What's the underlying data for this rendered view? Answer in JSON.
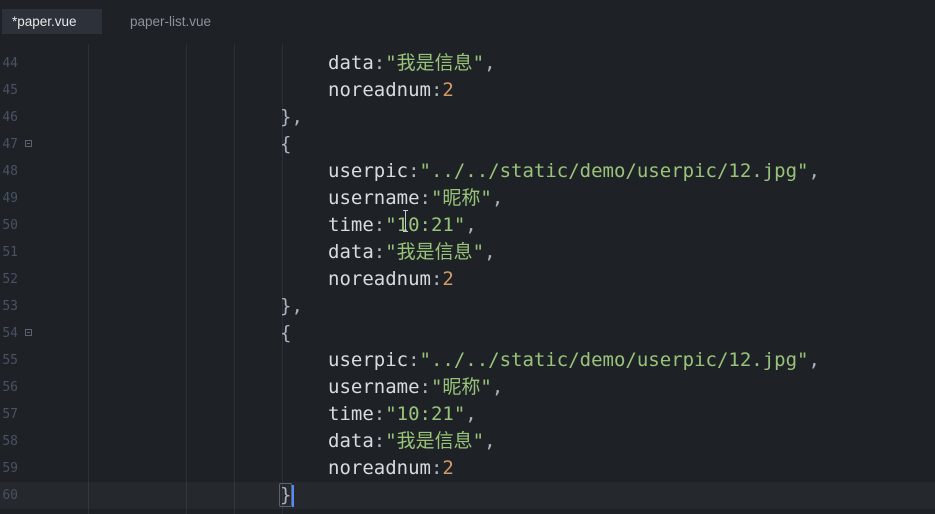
{
  "tabs": [
    {
      "label": "*paper.vue",
      "active": true
    },
    {
      "label": "paper-list.vue",
      "active": false
    }
  ],
  "colors": {
    "background": "#1e2227",
    "line_number": "#495162",
    "key": "#d7dae0",
    "string": "#98c379",
    "number": "#d19a66",
    "punctuation": "#abb2bf",
    "cursor": "#528bff"
  },
  "lines": [
    {
      "n": "44",
      "fold": false,
      "tokens": [
        [
          "key",
          "data"
        ],
        [
          "punc",
          ":"
        ],
        [
          "str",
          "\"我是信息\""
        ],
        [
          "punc",
          ","
        ]
      ],
      "indent": 2
    },
    {
      "n": "45",
      "fold": false,
      "tokens": [
        [
          "key",
          "noreadnum"
        ],
        [
          "punc",
          ":"
        ],
        [
          "num",
          "2"
        ]
      ],
      "indent": 2
    },
    {
      "n": "46",
      "fold": false,
      "tokens": [
        [
          "brace",
          "}"
        ],
        [
          "punc",
          ","
        ]
      ],
      "indent": 1
    },
    {
      "n": "47",
      "fold": true,
      "tokens": [
        [
          "brace",
          "{"
        ]
      ],
      "indent": 1
    },
    {
      "n": "48",
      "fold": false,
      "tokens": [
        [
          "key",
          "userpic"
        ],
        [
          "punc",
          ":"
        ],
        [
          "str",
          "\"../../static/demo/userpic/12.jpg\""
        ],
        [
          "punc",
          ","
        ]
      ],
      "indent": 2
    },
    {
      "n": "49",
      "fold": false,
      "tokens": [
        [
          "key",
          "username"
        ],
        [
          "punc",
          ":"
        ],
        [
          "str",
          "\"昵称\""
        ],
        [
          "punc",
          ","
        ]
      ],
      "indent": 2
    },
    {
      "n": "50",
      "fold": false,
      "tokens": [
        [
          "key",
          "time"
        ],
        [
          "punc",
          ":"
        ],
        [
          "str",
          "\"10:21\""
        ],
        [
          "punc",
          ","
        ]
      ],
      "indent": 2
    },
    {
      "n": "51",
      "fold": false,
      "tokens": [
        [
          "key",
          "data"
        ],
        [
          "punc",
          ":"
        ],
        [
          "str",
          "\"我是信息\""
        ],
        [
          "punc",
          ","
        ]
      ],
      "indent": 2
    },
    {
      "n": "52",
      "fold": false,
      "tokens": [
        [
          "key",
          "noreadnum"
        ],
        [
          "punc",
          ":"
        ],
        [
          "num",
          "2"
        ]
      ],
      "indent": 2
    },
    {
      "n": "53",
      "fold": false,
      "tokens": [
        [
          "brace",
          "}"
        ],
        [
          "punc",
          ","
        ]
      ],
      "indent": 1
    },
    {
      "n": "54",
      "fold": true,
      "tokens": [
        [
          "brace",
          "{"
        ]
      ],
      "indent": 1
    },
    {
      "n": "55",
      "fold": false,
      "tokens": [
        [
          "key",
          "userpic"
        ],
        [
          "punc",
          ":"
        ],
        [
          "str",
          "\"../../static/demo/userpic/12.jpg\""
        ],
        [
          "punc",
          ","
        ]
      ],
      "indent": 2
    },
    {
      "n": "56",
      "fold": false,
      "tokens": [
        [
          "key",
          "username"
        ],
        [
          "punc",
          ":"
        ],
        [
          "str",
          "\"昵称\""
        ],
        [
          "punc",
          ","
        ]
      ],
      "indent": 2
    },
    {
      "n": "57",
      "fold": false,
      "tokens": [
        [
          "key",
          "time"
        ],
        [
          "punc",
          ":"
        ],
        [
          "str",
          "\"10:21\""
        ],
        [
          "punc",
          ","
        ]
      ],
      "indent": 2
    },
    {
      "n": "58",
      "fold": false,
      "tokens": [
        [
          "key",
          "data"
        ],
        [
          "punc",
          ":"
        ],
        [
          "str",
          "\"我是信息\""
        ],
        [
          "punc",
          ","
        ]
      ],
      "indent": 2
    },
    {
      "n": "59",
      "fold": false,
      "tokens": [
        [
          "key",
          "noreadnum"
        ],
        [
          "punc",
          ":"
        ],
        [
          "num",
          "2"
        ]
      ],
      "indent": 2
    },
    {
      "n": "60",
      "fold": false,
      "tokens": [
        [
          "brace",
          "}"
        ]
      ],
      "indent": 1,
      "current": true,
      "bracket_match": true
    }
  ]
}
